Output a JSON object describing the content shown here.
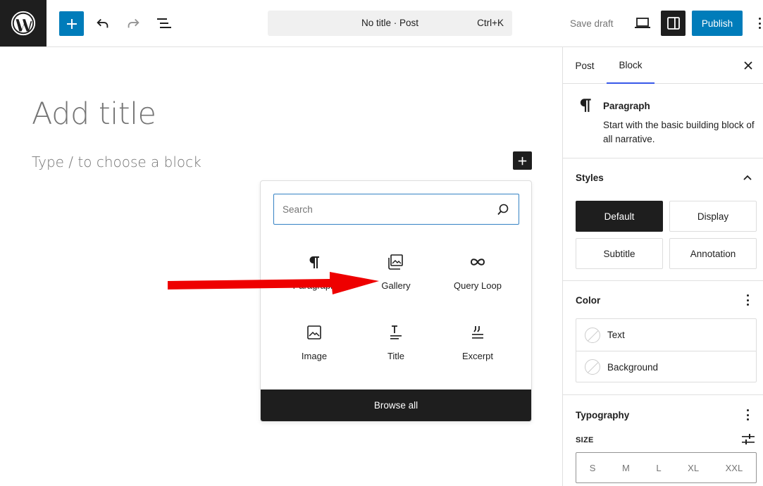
{
  "topbar": {
    "document_title": "No title · Post",
    "shortcut": "Ctrl+K",
    "save_draft": "Save draft",
    "publish": "Publish"
  },
  "editor": {
    "title_placeholder": "Add title",
    "block_placeholder": "Type / to choose a block"
  },
  "inserter": {
    "search_placeholder": "Search",
    "blocks": [
      {
        "label": "Paragraph",
        "icon": "paragraph-icon"
      },
      {
        "label": "Gallery",
        "icon": "gallery-icon"
      },
      {
        "label": "Query Loop",
        "icon": "query-loop-icon"
      },
      {
        "label": "Image",
        "icon": "image-icon"
      },
      {
        "label": "Title",
        "icon": "title-icon"
      },
      {
        "label": "Excerpt",
        "icon": "excerpt-icon"
      }
    ],
    "browse_all": "Browse all"
  },
  "sidebar": {
    "tabs": [
      {
        "label": "Post"
      },
      {
        "label": "Block"
      }
    ],
    "active_tab": "Block",
    "block_card": {
      "title": "Paragraph",
      "description": "Start with the basic building block of all narrative."
    },
    "styles": {
      "title": "Styles",
      "options": [
        "Default",
        "Display",
        "Subtitle",
        "Annotation"
      ],
      "selected": "Default"
    },
    "color": {
      "title": "Color",
      "items": [
        "Text",
        "Background"
      ]
    },
    "typography": {
      "title": "Typography",
      "size_label": "SIZE",
      "sizes": [
        "S",
        "M",
        "L",
        "XL",
        "XXL"
      ]
    }
  },
  "colors": {
    "accent": "#007cba",
    "dark": "#1e1e1e",
    "annotation_arrow": "#ee0000",
    "tab_indicator": "#3858e9"
  }
}
